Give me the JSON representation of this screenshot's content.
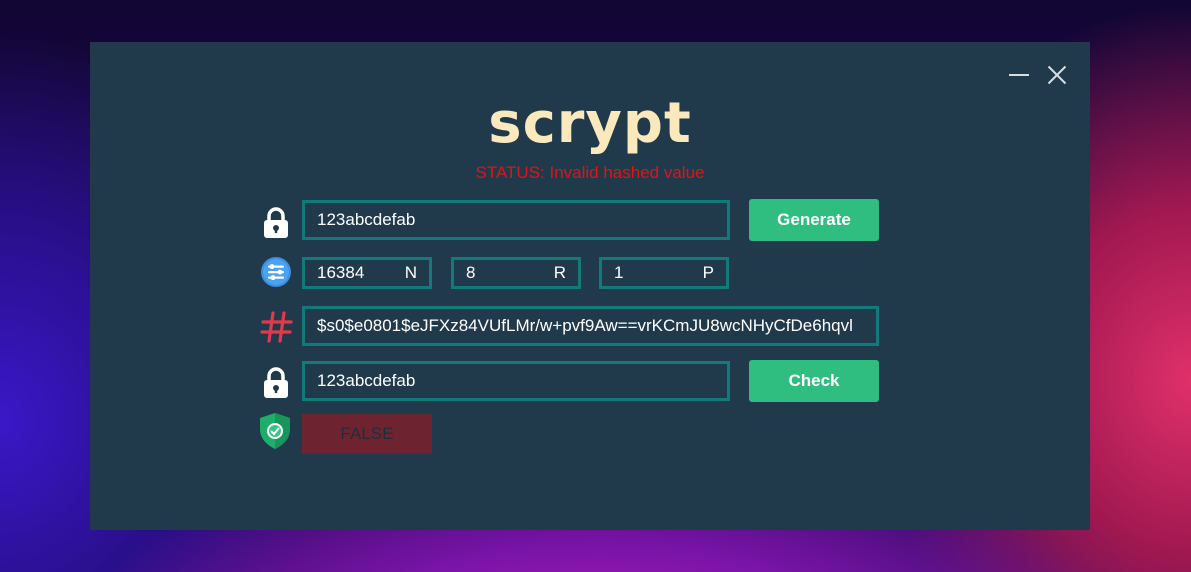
{
  "window": {
    "title": "scrypt",
    "status": "STATUS: Invalid hashed value"
  },
  "titlebar": {
    "minimize_icon": "minimize-icon",
    "close_icon": "close-icon"
  },
  "generate_row": {
    "icon": "lock-icon",
    "password_value": "123abcdefab",
    "button_label": "Generate"
  },
  "params_row": {
    "icon": "sliders-icon",
    "n": {
      "value": "16384",
      "label": "N"
    },
    "r": {
      "value": "8",
      "label": "R"
    },
    "p": {
      "value": "1",
      "label": "P"
    }
  },
  "hash_row": {
    "icon": "hash-icon",
    "hash_value": "$s0$e0801$eJFXz84VUfLMr/w+pvf9Aw==vrKCmJU8wcNHyCfDe6hqvl"
  },
  "check_row": {
    "icon": "lock-icon",
    "password_value": "123abcdefab",
    "button_label": "Check"
  },
  "result_row": {
    "icon": "shield-check-icon",
    "result_value": "FALSE"
  },
  "colors": {
    "window_bg": "#203a4c",
    "title": "#fbe9be",
    "status": "#e01414",
    "field_border": "#117b7b",
    "button": "#2fbe80",
    "result_bg": "#6e2430"
  }
}
